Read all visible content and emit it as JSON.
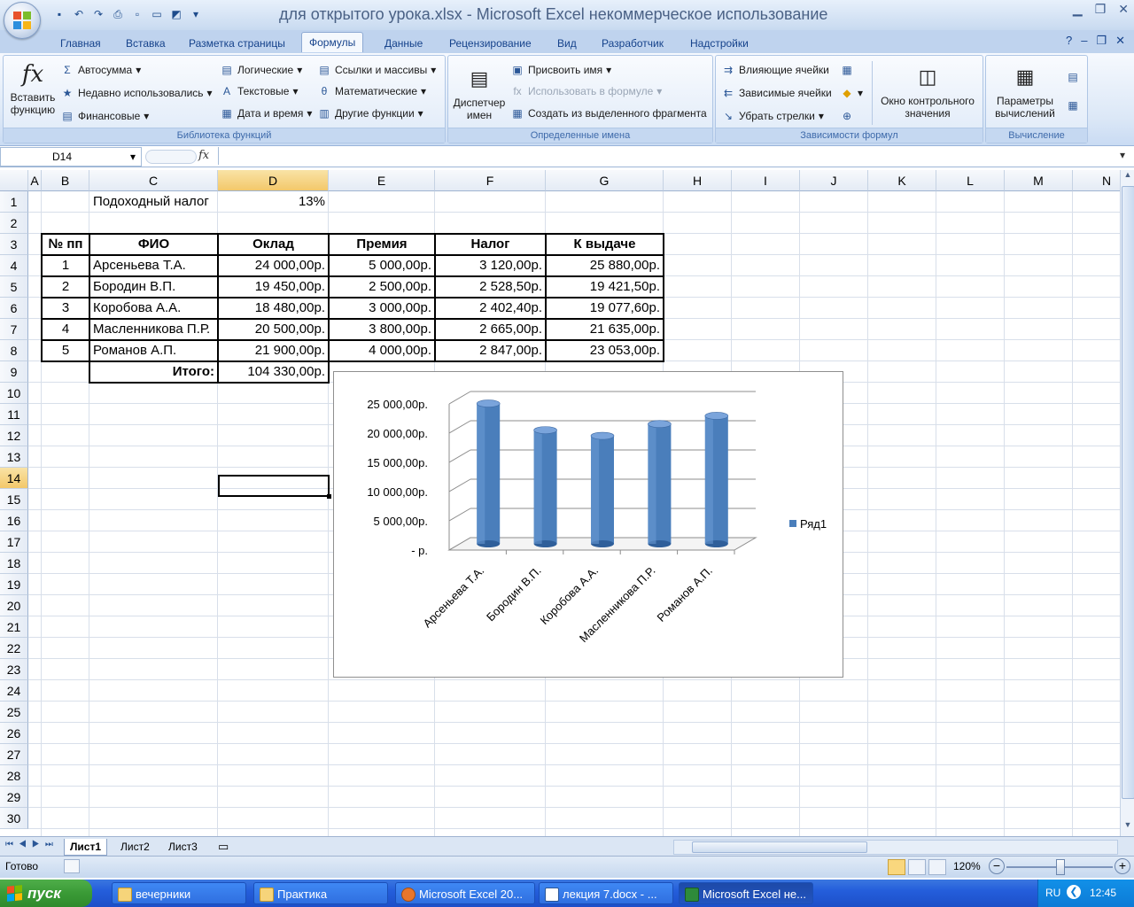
{
  "window": {
    "title": "для открытого урока.xlsx - Microsoft Excel некоммерческое использование"
  },
  "ribbon": {
    "tabs": [
      "Главная",
      "Вставка",
      "Разметка страницы",
      "Формулы",
      "Данные",
      "Рецензирование",
      "Вид",
      "Разработчик",
      "Надстройки"
    ],
    "active_tab": "Формулы",
    "groups": {
      "function_library": {
        "label": "Библиотека функций",
        "insert_function": "Вставить функцию",
        "autosum": "Автосумма",
        "recent": "Недавно использовались",
        "financial": "Финансовые",
        "logical": "Логические",
        "text": "Текстовые",
        "datetime": "Дата и время",
        "lookup": "Ссылки и массивы",
        "math": "Математические",
        "other": "Другие функции"
      },
      "defined_names": {
        "label": "Определенные имена",
        "name_manager": "Диспетчер имен",
        "define_name": "Присвоить имя",
        "use_in_formula": "Использовать в формуле",
        "create_from_selection": "Создать из выделенного фрагмента"
      },
      "formula_auditing": {
        "label": "Зависимости формул",
        "trace_precedents": "Влияющие ячейки",
        "trace_dependents": "Зависимые ячейки",
        "remove_arrows": "Убрать стрелки",
        "watch_window": "Окно контрольного значения"
      },
      "calculation": {
        "label": "Вычисление",
        "options": "Параметры вычислений"
      }
    }
  },
  "formula_bar": {
    "name_box": "D14",
    "fx": "fx",
    "formula": ""
  },
  "sheet": {
    "columns": [
      "A",
      "B",
      "C",
      "D",
      "E",
      "F",
      "G",
      "H",
      "I",
      "J",
      "K",
      "L",
      "M",
      "N"
    ],
    "rows": [
      "1",
      "2",
      "3",
      "4",
      "5",
      "6",
      "7",
      "8",
      "9",
      "10",
      "11",
      "12",
      "13",
      "14",
      "15",
      "16",
      "17",
      "18",
      "19",
      "20",
      "21",
      "22",
      "23",
      "24",
      "25",
      "26",
      "27",
      "28",
      "29",
      "30"
    ],
    "selected_column": "D",
    "selected_row": "14",
    "tax_label": "Подоходный налог",
    "tax_rate": "13%",
    "headers": [
      "№ пп",
      "ФИО",
      "Оклад",
      "Премия",
      "Налог",
      "К выдаче"
    ],
    "records": [
      [
        "1",
        "Арсеньева Т.А.",
        "24 000,00р.",
        "5 000,00р.",
        "3 120,00р.",
        "25 880,00р."
      ],
      [
        "2",
        "Бородин В.П.",
        "19 450,00р.",
        "2 500,00р.",
        "2 528,50р.",
        "19 421,50р."
      ],
      [
        "3",
        "Коробова А.А.",
        "18 480,00р.",
        "3 000,00р.",
        "2 402,40р.",
        "19 077,60р."
      ],
      [
        "4",
        "Масленникова П.Р.",
        "20 500,00р.",
        "3 800,00р.",
        "2 665,00р.",
        "21 635,00р."
      ],
      [
        "5",
        "Романов А.П.",
        "21 900,00р.",
        "4 000,00р.",
        "2 847,00р.",
        "23 053,00р."
      ]
    ],
    "total_label": "Итого:",
    "total_value": "104 330,00р."
  },
  "chart_data": {
    "type": "bar",
    "title": "",
    "xlabel": "",
    "ylabel": "",
    "categories": [
      "Арсеньева Т.А.",
      "Бородин В.П.",
      "Коробова А.А.",
      "Масленникова П.Р.",
      "Романов А.П."
    ],
    "series": [
      {
        "name": "Ряд1",
        "values": [
          24000,
          19450,
          18480,
          20500,
          21900
        ],
        "color": "#4a7ebb"
      }
    ],
    "ylim": [
      0,
      25000
    ],
    "yticks": [
      "-  р.",
      "5 000,00р.",
      "10 000,00р.",
      "15 000,00р.",
      "20 000,00р.",
      "25 000,00р."
    ],
    "grid": true,
    "legend": "right",
    "style": "3d-cylinder"
  },
  "sheet_tabs": {
    "tabs": [
      "Лист1",
      "Лист2",
      "Лист3"
    ],
    "active": "Лист1"
  },
  "status": {
    "ready": "Готово",
    "zoom": "120%"
  },
  "taskbar": {
    "start": "пуск",
    "tasks": [
      "вечерники",
      "Практика",
      "Microsoft Excel 20...",
      "лекция 7.docx - ...",
      "Microsoft Excel не..."
    ],
    "active_task": "Microsoft Excel не...",
    "lang": "RU",
    "clock": "12:45"
  },
  "colors": {
    "ribbon_accent": "#15428b",
    "selection_header": "#f3c86a",
    "taskbar": "#245edb",
    "start_button": "#3a9a36"
  }
}
